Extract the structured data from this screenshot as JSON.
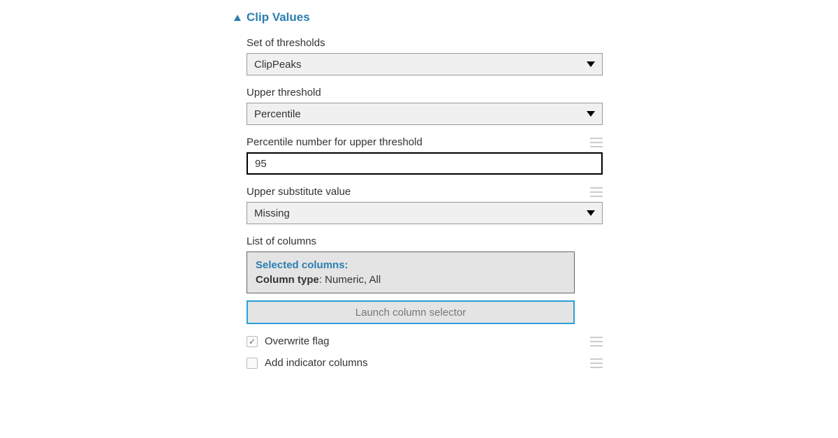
{
  "section": {
    "title": "Clip Values"
  },
  "fields": {
    "thresholds": {
      "label": "Set of thresholds",
      "value": "ClipPeaks"
    },
    "upper_threshold": {
      "label": "Upper threshold",
      "value": "Percentile"
    },
    "percentile_number": {
      "label": "Percentile number for upper threshold",
      "value": "95"
    },
    "upper_substitute": {
      "label": "Upper substitute value",
      "value": "Missing"
    },
    "list_columns": {
      "label": "List of columns",
      "selected_title": "Selected columns:",
      "type_label": "Column type",
      "type_value": ": Numeric, All",
      "launch_label": "Launch column selector"
    },
    "overwrite": {
      "label": "Overwrite flag",
      "checked": true
    },
    "add_indicator": {
      "label": "Add indicator columns",
      "checked": false
    }
  }
}
